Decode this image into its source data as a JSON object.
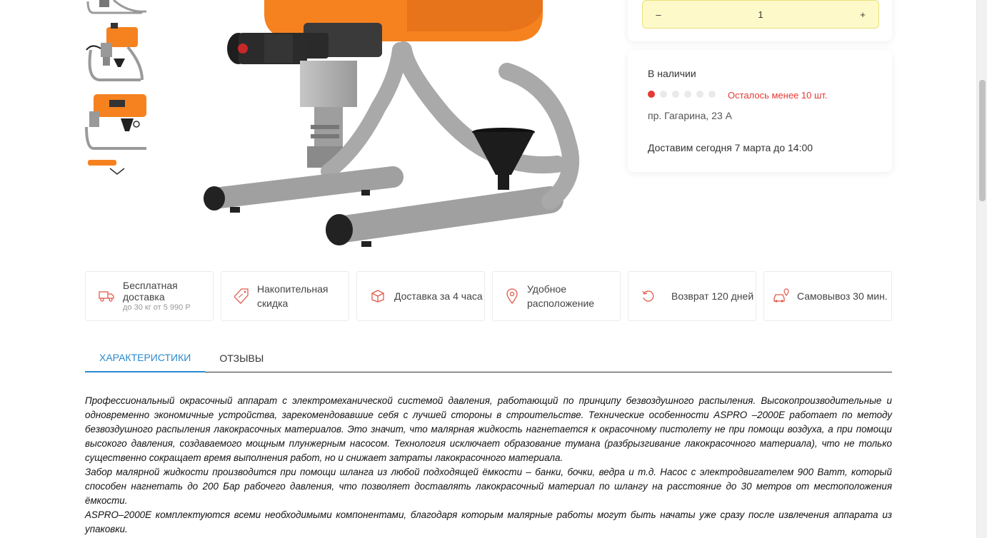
{
  "thumbnails": [
    {
      "alt": "thumbnail-1",
      "icon": "sprayer-thumbnail"
    },
    {
      "alt": "thumbnail-2",
      "icon": "sprayer-thumbnail"
    },
    {
      "alt": "thumbnail-3",
      "icon": "sprayer-thumbnail"
    },
    {
      "alt": "thumbnail-4",
      "icon": "sprayer-thumbnail"
    }
  ],
  "quantity": {
    "minus": "–",
    "value": "1",
    "plus": "+"
  },
  "stock": {
    "title": "В наличии",
    "dots_active": 1,
    "dots_total": 6,
    "warning": "Осталось менее 10 шт.",
    "address": "пр. Гагарина, 23 А",
    "delivery": "Доставим сегодня 7 марта до 14:00"
  },
  "features": [
    {
      "icon": "truck-icon",
      "title": "Бесплатная доставка",
      "sub": "до 30 кг от 5 990 Р"
    },
    {
      "icon": "discount-tag-icon",
      "title": "Накопительная скидка",
      "sub": ""
    },
    {
      "icon": "box-icon",
      "title": "Доставка за 4 часа",
      "sub": ""
    },
    {
      "icon": "location-pin-icon",
      "title": "Удобное расположение",
      "sub": ""
    },
    {
      "icon": "return-icon",
      "title": "Возврат 120 дней",
      "sub": ""
    },
    {
      "icon": "car-pin-icon",
      "title": "Самовывоз 30 мин.",
      "sub": ""
    }
  ],
  "tabs": [
    {
      "label": "Характеристики",
      "active": true
    },
    {
      "label": "Отзывы",
      "active": false
    }
  ],
  "description": [
    "Профессиональный окрасочный аппарат с электромеханической системой давления, работающий по принципу безвоздушного распыления. Высокопроизводительные и одновременно экономичные устройства, зарекомендовавшие себя с лучшей стороны в строительстве. Технические особенности ASPRO –2000E работает по методу безвоздушного распыления лакокрасочных материалов. Это значит, что малярная жидкость нагнетается к окрасочному пистолету не при помощи воздуха, а при помощи высокого давления, создаваемого мощным плунжерным насосом. Технология исключает образование тумана (разбрызгивание лакокрасочного материала), что не только существенно сокращает время выполнения работ, но и снижает затраты лакокрасочного материала.",
    "Забор малярной жидкости производится при помощи шланга из любой подходящей ёмкости – банки, бочки, ведра и т.д. Насос с электродвигателем 900 Ватт, который способен нагнетать до 200 Бар рабочего давления, что позволяет доставлять лакокрасочный материал по шлангу на расстояние до 30 метров от местоположения ёмкости.",
    "ASPRO–2000E комплектуются всеми необходимыми компонентами, благодаря которым малярные работы могут быть начаты уже сразу после извлечения аппарата из упаковки."
  ],
  "colors": {
    "accent": "#2a8bcf",
    "warning": "#e53935",
    "qty_bg": "#fdf9c9",
    "feature_icon": "#e05a4b",
    "product_orange": "#f5821f"
  }
}
